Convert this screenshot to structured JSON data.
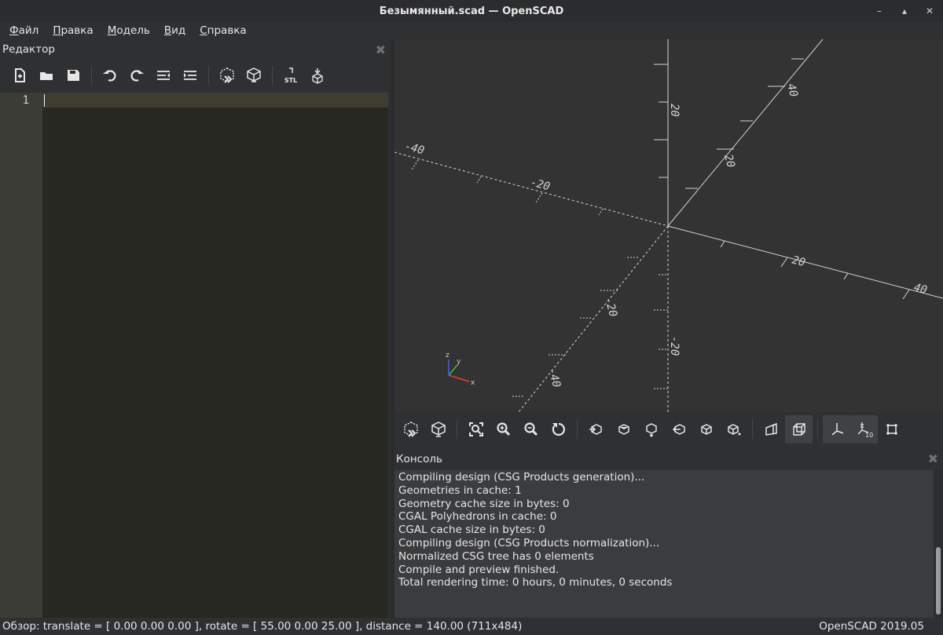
{
  "window": {
    "title": "Безымянный.scad — OpenSCAD",
    "controls": [
      "minimize-icon",
      "maximize-icon",
      "close-icon"
    ]
  },
  "menu": [
    {
      "label": "Файл"
    },
    {
      "label": "Правка"
    },
    {
      "label": "Модель"
    },
    {
      "label": "Вид"
    },
    {
      "label": "Справка"
    }
  ],
  "editor": {
    "title": "Редактор",
    "close_icon": "close-icon",
    "toolbar": [
      "new-file-icon",
      "open-file-icon",
      "save-icon",
      "undo-icon",
      "redo-icon",
      "unindent-icon",
      "indent-icon",
      "preview-icon",
      "render-icon",
      "export-stl-icon",
      "send-to-printer-icon"
    ],
    "stl_label": "STL",
    "line_numbers": [
      "1"
    ],
    "content": ""
  },
  "viewport": {
    "axis_labels": {
      "x_pos": [
        "20",
        "40"
      ],
      "x_neg": [
        "-20",
        "-40"
      ],
      "y_pos": [
        "20",
        "40"
      ],
      "y_neg": [
        "-20",
        "-40"
      ],
      "z_pos": "20",
      "z_neg": "-20"
    },
    "gizmo": {
      "x": "x",
      "y": "y",
      "z": "z"
    }
  },
  "view_toolbar": [
    "preview-icon",
    "render-icon",
    "view-all-icon",
    "zoom-in-icon",
    "zoom-out-icon",
    "reset-view-icon",
    "view-right-icon",
    "view-top-icon",
    "view-bottom-icon",
    "view-left-icon",
    "view-front-icon",
    "view-back-icon",
    "perspective-icon",
    "orthogonal-icon",
    "show-axes-icon",
    "show-scale-markers-icon",
    "show-edges-icon"
  ],
  "scale_marker_label": "10",
  "console": {
    "title": "Консоль",
    "lines": [
      "Compiling design (CSG Products generation)...",
      "Geometries in cache: 1",
      "Geometry cache size in bytes: 0",
      "CGAL Polyhedrons in cache: 0",
      "CGAL cache size in bytes: 0",
      "Compiling design (CSG Products normalization)...",
      "Normalized CSG tree has 0 elements",
      "Compile and preview finished.",
      "Total rendering time: 0 hours, 0 minutes, 0 seconds"
    ]
  },
  "status": {
    "left": "Обзор: translate = [ 0.00 0.00 0.00 ], rotate = [ 55.00 0.00 25.00 ], distance = 140.00 (711x484)",
    "right": "OpenSCAD 2019.05"
  }
}
